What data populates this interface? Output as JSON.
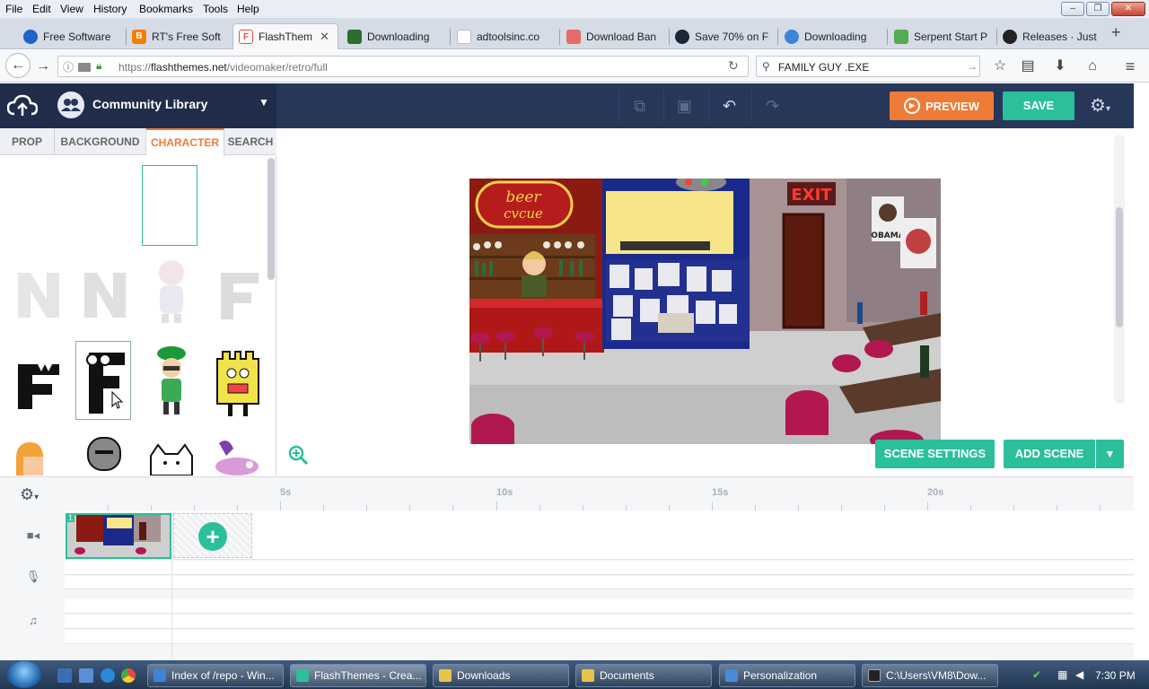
{
  "browser": {
    "menu": [
      "File",
      "Edit",
      "View",
      "History",
      "Bookmarks",
      "Tools",
      "Help"
    ],
    "window_controls": [
      "–",
      "❐",
      "✕"
    ],
    "tabs": [
      {
        "label": "Free Software",
        "color": "#1d63c8"
      },
      {
        "label": "RT's Free Soft",
        "color": "#f57d00"
      },
      {
        "label": "FlashThem",
        "color": "#e94b4b"
      },
      {
        "label": "Downloading",
        "color": "#2c6e2c"
      },
      {
        "label": "adtoolsinc.co",
        "color": "#ffffff"
      },
      {
        "label": "Download Ban",
        "color": "#e76a6a"
      },
      {
        "label": "Save 70% on F",
        "color": "#1b2838"
      },
      {
        "label": "Downloading",
        "color": "#3b84d8"
      },
      {
        "label": "Serpent Start P",
        "color": "#55aa55"
      },
      {
        "label": "Releases · Just",
        "color": "#222222"
      }
    ],
    "active_tab_close": "✕",
    "new_tab": "+",
    "url_prefix": "https://",
    "url_domain": "flashthemes.net",
    "url_path": "/videomaker/retro/full",
    "search_value": "FAMILY GUY .EXE"
  },
  "app": {
    "library_title": "Community Library",
    "preview_label": "PREVIEW",
    "save_label": "SAVE",
    "library_tabs": [
      "PROP",
      "BACKGROUND",
      "CHARACTER",
      "SEARCH"
    ],
    "active_library_tab": "CHARACTER",
    "scene_settings_label": "SCENE SETTINGS",
    "add_scene_label": "ADD SCENE",
    "stage_signs": {
      "beer": "beer",
      "beer2": "cvcue",
      "exit": "EXIT",
      "poster": "OBAMA"
    },
    "accent_orange": "#ef7b36",
    "accent_teal": "#2bbf9b",
    "header_navy": "#27375a"
  },
  "timeline": {
    "ticks": [
      "5s",
      "10s",
      "15s",
      "20s"
    ],
    "scene_number": "1",
    "track_icons": [
      "camera-icon",
      "microphone-icon",
      "music-note-icon"
    ]
  },
  "taskbar": {
    "tasks": [
      {
        "label": "Index of /repo - Win...",
        "color": "#3b84d8"
      },
      {
        "label": "FlashThemes - Crea...",
        "color": "#2bbf9b"
      },
      {
        "label": "Downloads",
        "color": "#e8c34a"
      },
      {
        "label": "Documents",
        "color": "#e8c34a"
      },
      {
        "label": "Personalization",
        "color": "#4a8ad8"
      },
      {
        "label": "C:\\Users\\VM8\\Dow...",
        "color": "#222222"
      }
    ],
    "clock": "7:30 PM"
  }
}
